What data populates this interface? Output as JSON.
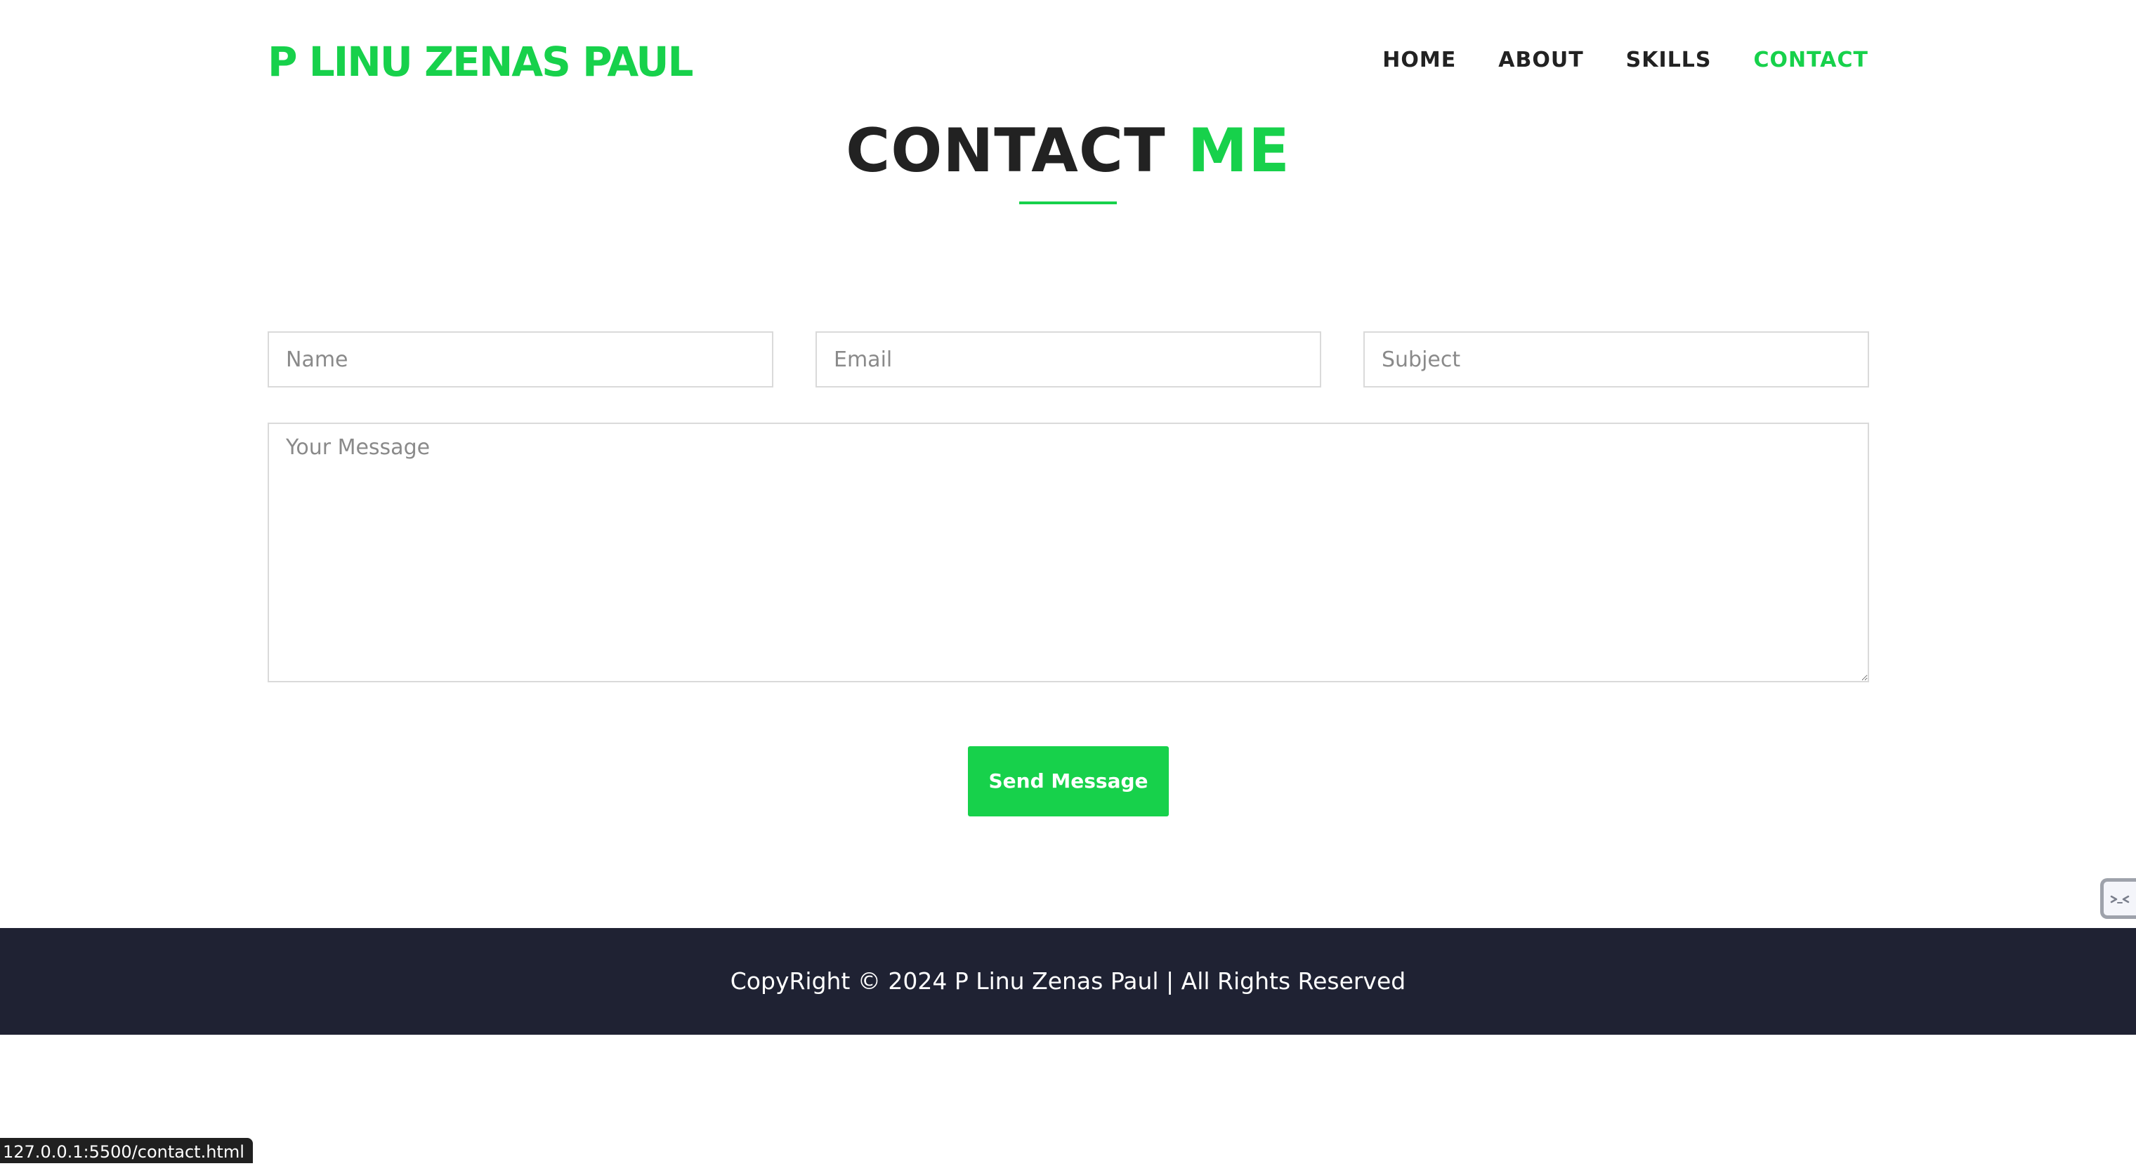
{
  "header": {
    "logo": "P LINU ZENAS PAUL",
    "nav": [
      {
        "label": "HOME",
        "active": false
      },
      {
        "label": "ABOUT",
        "active": false
      },
      {
        "label": "SKILLS",
        "active": false
      },
      {
        "label": "CONTACT",
        "active": true
      }
    ]
  },
  "section": {
    "title_part1": "CONTACT",
    "title_part2": "ME"
  },
  "form": {
    "name_placeholder": "Name",
    "email_placeholder": "Email",
    "subject_placeholder": "Subject",
    "message_placeholder": "Your Message",
    "submit_label": "Send Message"
  },
  "footer": {
    "copyright": "CopyRight © 2024 P Linu Zenas Paul | All Rights Reserved"
  },
  "status_bar": {
    "url": "127.0.0.1:5500/contact.html"
  },
  "colors": {
    "accent": "#17d14b",
    "text_dark": "#222222",
    "footer_bg": "#1f2233",
    "status_bg": "#202020",
    "status_text": "#ffffff"
  }
}
